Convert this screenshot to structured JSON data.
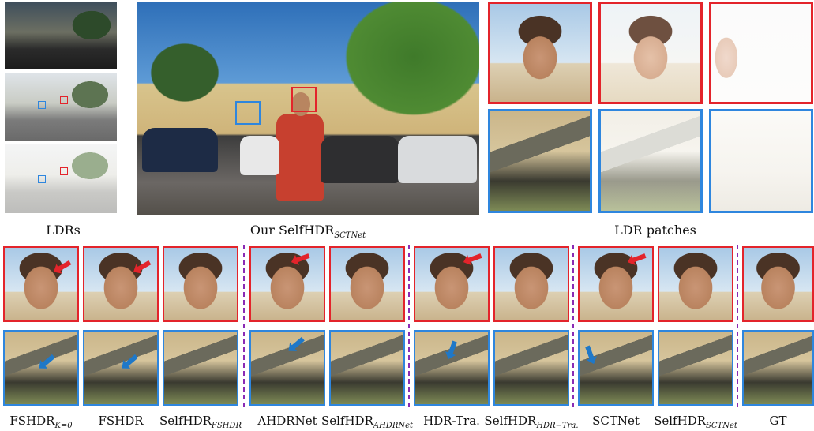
{
  "captions": {
    "ldrs": "LDRs",
    "main_prefix": "Our SelfHDR",
    "main_sub": "SCTNet",
    "ldr_patches": "LDR patches"
  },
  "methods": [
    {
      "label": "FSHDR",
      "sub": "K=0"
    },
    {
      "label": "FSHDR",
      "sub": ""
    },
    {
      "label": "SelfHDR",
      "sub": "FSHDR"
    },
    {
      "label": "AHDRNet",
      "sub": ""
    },
    {
      "label": "SelfHDR",
      "sub": "AHDRNet"
    },
    {
      "label": "HDR-Tra.",
      "sub": ""
    },
    {
      "label": "SelfHDR",
      "sub": "HDR−Tra."
    },
    {
      "label": "SCTNet",
      "sub": ""
    },
    {
      "label": "SelfHDR",
      "sub": "SCTNet"
    },
    {
      "label": "GT",
      "sub": ""
    }
  ],
  "colors": {
    "face_box": "#e3242b",
    "awning_box": "#2e86de",
    "separator": "#8a2bb5"
  }
}
